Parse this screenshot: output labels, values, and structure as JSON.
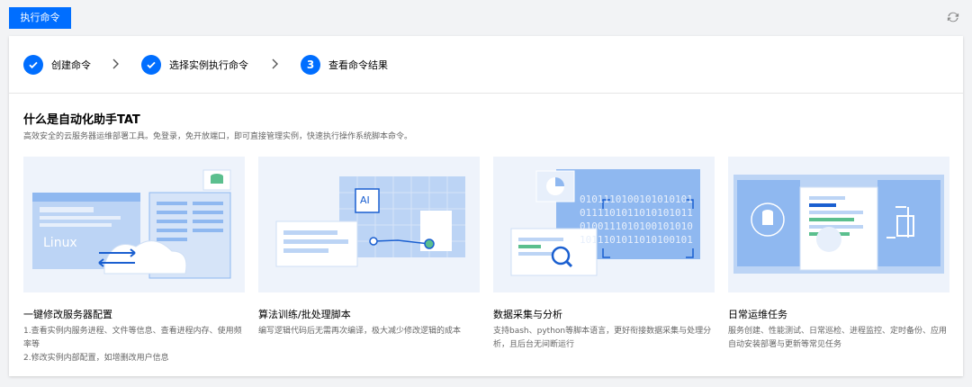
{
  "toolbar": {
    "execute_label": "执行命令",
    "refresh_icon": "refresh-icon"
  },
  "steps": [
    {
      "label": "创建命令",
      "status": "done",
      "icon": "check-icon"
    },
    {
      "label": "选择实例执行命令",
      "status": "done",
      "icon": "check-icon"
    },
    {
      "label": "查看命令结果",
      "status": "current",
      "number": "3"
    }
  ],
  "intro": {
    "title": "什么是自动化助手TAT",
    "subtitle": "高效安全的云服务器运维部署工具。免登录，免开放端口，即可直接管理实例，快速执行操作系统脚本命令。"
  },
  "features": [
    {
      "title": "一键修改服务器配置",
      "desc": [
        "1.查看实例内服务进程、文件等信息、查看进程内存、使用频率等",
        "2.修改实例内部配置，如增删改用户信息"
      ],
      "illus_text": "Linux"
    },
    {
      "title": "算法训练/批处理脚本",
      "desc": [
        "编写逻辑代码后无需再次编译，极大减少修改逻辑的成本"
      ],
      "illus_text": "AI"
    },
    {
      "title": "数据采集与分析",
      "desc": [
        "支持bash、python等脚本语言，更好衔接数据采集与处理分析，且后台无间断运行"
      ],
      "illus_text": "0101110100101010101\n0111101011010101011\n0100111010100101010\n1011101011010100101"
    },
    {
      "title": "日常运维任务",
      "desc": [
        "服务创建、性能测试、日常巡检、进程监控、定时备份、应用自动安装部署与更新等常见任务"
      ],
      "illus_text": ""
    }
  ],
  "colors": {
    "primary": "#006eff",
    "illustration_bg": "#eef3fb",
    "illustration_blue": "#8fb8f0"
  }
}
